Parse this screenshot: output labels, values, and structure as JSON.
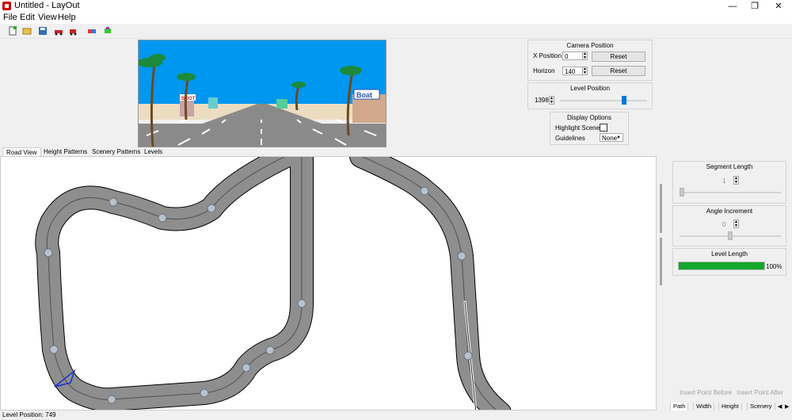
{
  "window": {
    "title": "Untitled - LayOut",
    "minimize_glyph": "—",
    "maximize_glyph": "❐",
    "close_glyph": "✕"
  },
  "menu": [
    "File",
    "Edit",
    "View",
    "Help"
  ],
  "toolbar_icons": [
    "new-icon",
    "open-icon",
    "save-icon",
    "car-icon",
    "car-alt-icon",
    "color-icon",
    "tools-icon"
  ],
  "preview": {
    "sign_left": "BOOT",
    "sign_right": "Boat"
  },
  "camera": {
    "title": "Camera Position",
    "x_label": "X Position",
    "x_value": "0",
    "x_reset": "Reset",
    "horizon_label": "Horizon",
    "horizon_value": "140",
    "horizon_reset": "Reset"
  },
  "level_position": {
    "title": "Level Position",
    "value": "1398",
    "slider_fraction": 0.74
  },
  "display": {
    "title": "Display Options",
    "highlight_label": "Highlight Scenery",
    "guidelines_label": "Guidelines",
    "guidelines_value": "None"
  },
  "tabs": [
    "Road View",
    "Height Patterns",
    "Scenery Patterns",
    "Levels"
  ],
  "segment": {
    "title": "Segment Length",
    "value": "1"
  },
  "angle": {
    "title": "Angle Increment",
    "value": "0"
  },
  "level_length": {
    "title": "Level Length",
    "percent_label": "100%",
    "fill_fraction": 1.0,
    "fill_color": "#12a62b"
  },
  "buttons": {
    "insert_before": "Insert Point Before",
    "insert_after": "Insert Point After"
  },
  "bottom_tabs": [
    "Path",
    "Width",
    "Height",
    "Scenery"
  ],
  "status": {
    "text": "Level Position: 749"
  },
  "colors": {
    "sky": "#0097f0",
    "road": "#8a8a8a",
    "node": "#b8c2cc"
  }
}
